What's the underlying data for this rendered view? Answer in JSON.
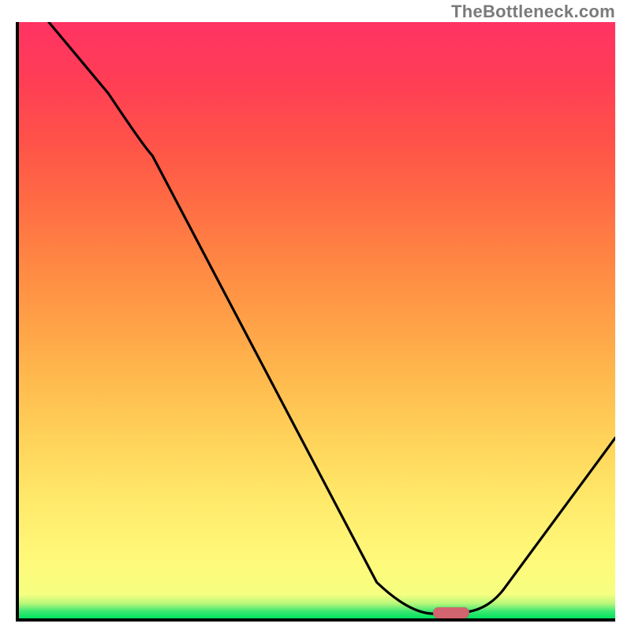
{
  "watermark": "TheBottleneck.com",
  "colors": {
    "gradient_top": "#ff3363",
    "gradient_mid": "#ffd35a",
    "gradient_bottom": "#00e35e",
    "curve": "#000000",
    "marker": "#d1646e",
    "axes": "#000000"
  },
  "chart_data": {
    "type": "line",
    "title": "",
    "xlabel": "",
    "ylabel": "",
    "xlim": [
      0,
      100
    ],
    "ylim": [
      0,
      100
    ],
    "grid": false,
    "legend": false,
    "series": [
      {
        "name": "bottleneck-curve",
        "x": [
          5,
          15,
          22,
          30,
          40,
          50,
          60,
          66,
          70,
          75,
          80,
          90,
          100
        ],
        "y": [
          100,
          88,
          78,
          66,
          50,
          34,
          17,
          6,
          1,
          0,
          3,
          15,
          30
        ]
      }
    ],
    "annotations": [
      {
        "name": "optimal-marker",
        "x": 73,
        "y": 0.8,
        "shape": "pill",
        "color": "#d1646e"
      }
    ]
  }
}
